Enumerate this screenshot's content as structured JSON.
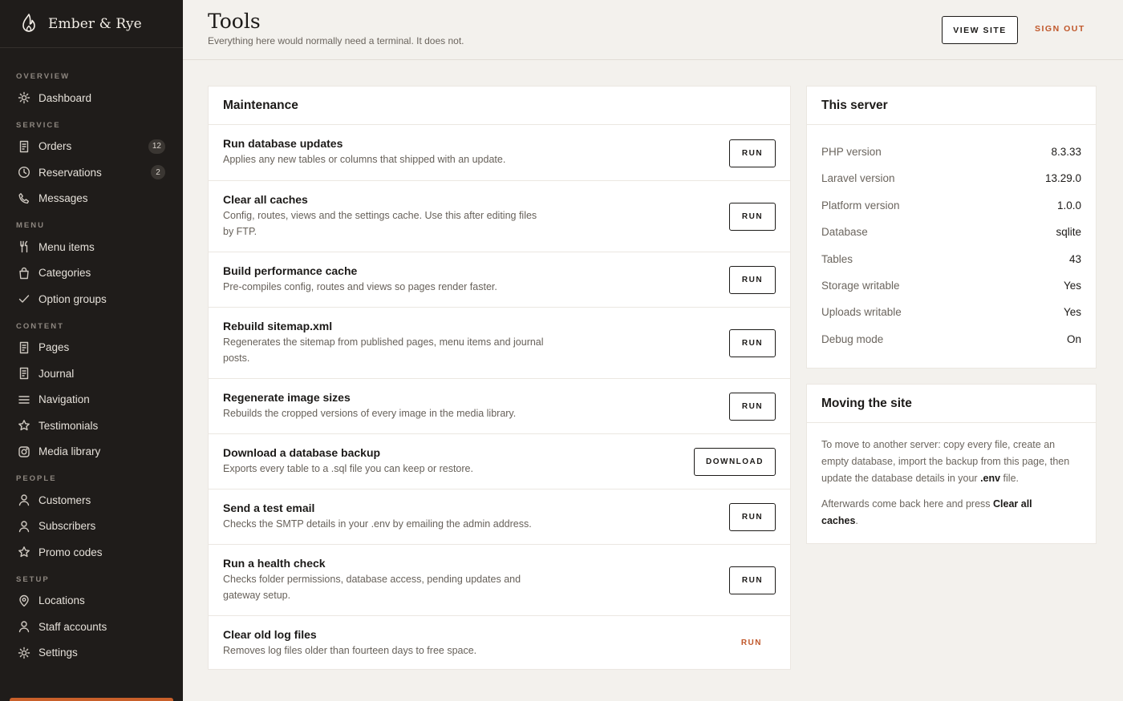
{
  "brand": {
    "name": "Ember & Rye"
  },
  "sidebar": {
    "sections": [
      {
        "label": "OVERVIEW",
        "items": [
          {
            "label": "Dashboard",
            "icon": "sun-icon"
          }
        ]
      },
      {
        "label": "SERVICE",
        "items": [
          {
            "label": "Orders",
            "icon": "receipt-icon",
            "badge": "12"
          },
          {
            "label": "Reservations",
            "icon": "clock-icon",
            "badge": "2"
          },
          {
            "label": "Messages",
            "icon": "phone-icon"
          }
        ]
      },
      {
        "label": "MENU",
        "items": [
          {
            "label": "Menu items",
            "icon": "utensils-icon"
          },
          {
            "label": "Categories",
            "icon": "bag-icon"
          },
          {
            "label": "Option groups",
            "icon": "check-icon"
          }
        ]
      },
      {
        "label": "CONTENT",
        "items": [
          {
            "label": "Pages",
            "icon": "document-icon"
          },
          {
            "label": "Journal",
            "icon": "document-icon"
          },
          {
            "label": "Navigation",
            "icon": "menu-lines-icon"
          },
          {
            "label": "Testimonials",
            "icon": "star-icon"
          },
          {
            "label": "Media library",
            "icon": "camera-icon"
          }
        ]
      },
      {
        "label": "PEOPLE",
        "items": [
          {
            "label": "Customers",
            "icon": "user-icon"
          },
          {
            "label": "Subscribers",
            "icon": "user-icon"
          },
          {
            "label": "Promo codes",
            "icon": "star-icon"
          }
        ]
      },
      {
        "label": "SETUP",
        "items": [
          {
            "label": "Locations",
            "icon": "pin-icon"
          },
          {
            "label": "Staff accounts",
            "icon": "user-icon"
          },
          {
            "label": "Settings",
            "icon": "gear-icon"
          }
        ]
      }
    ],
    "accent_color": "#c9602a"
  },
  "header": {
    "title": "Tools",
    "subtitle": "Everything here would normally need a terminal. It does not.",
    "view_site": "VIEW SITE",
    "sign_out": "SIGN OUT"
  },
  "maintenance": {
    "title": "Maintenance",
    "tasks": [
      {
        "title": "Run database updates",
        "desc": "Applies any new tables or columns that shipped with an update.",
        "action": "RUN"
      },
      {
        "title": "Clear all caches",
        "desc": "Config, routes, views and the settings cache. Use this after editing files by FTP.",
        "action": "RUN"
      },
      {
        "title": "Build performance cache",
        "desc": "Pre-compiles config, routes and views so pages render faster.",
        "action": "RUN"
      },
      {
        "title": "Rebuild sitemap.xml",
        "desc": "Regenerates the sitemap from published pages, menu items and journal posts.",
        "action": "RUN"
      },
      {
        "title": "Regenerate image sizes",
        "desc": "Rebuilds the cropped versions of every image in the media library.",
        "action": "RUN"
      },
      {
        "title": "Download a database backup",
        "desc": "Exports every table to a .sql file you can keep or restore.",
        "action": "DOWNLOAD"
      },
      {
        "title": "Send a test email",
        "desc": "Checks the SMTP details in your .env by emailing the admin address.",
        "action": "RUN"
      },
      {
        "title": "Run a health check",
        "desc": "Checks folder permissions, database access, pending updates and gateway setup.",
        "action": "RUN"
      },
      {
        "title": "Clear old log files",
        "desc": "Removes log files older than fourteen days to free space.",
        "action": "RUN"
      }
    ]
  },
  "server": {
    "title": "This server",
    "rows": [
      {
        "key": "PHP version",
        "value": "8.3.33"
      },
      {
        "key": "Laravel version",
        "value": "13.29.0"
      },
      {
        "key": "Platform version",
        "value": "1.0.0"
      },
      {
        "key": "Database",
        "value": "sqlite"
      },
      {
        "key": "Tables",
        "value": "43"
      },
      {
        "key": "Storage writable",
        "value": "Yes"
      },
      {
        "key": "Uploads writable",
        "value": "Yes"
      },
      {
        "key": "Debug mode",
        "value": "On"
      }
    ]
  },
  "moving": {
    "title": "Moving the site",
    "p1_text": "To move to another server: copy every file, create an empty database, import the backup from this page, then update the database details in your ",
    "p1_bold": ".env",
    "p1_end": " file.",
    "p2_text": "Afterwards come back here and press ",
    "p2_bold": "Clear all caches",
    "p2_end": "."
  }
}
